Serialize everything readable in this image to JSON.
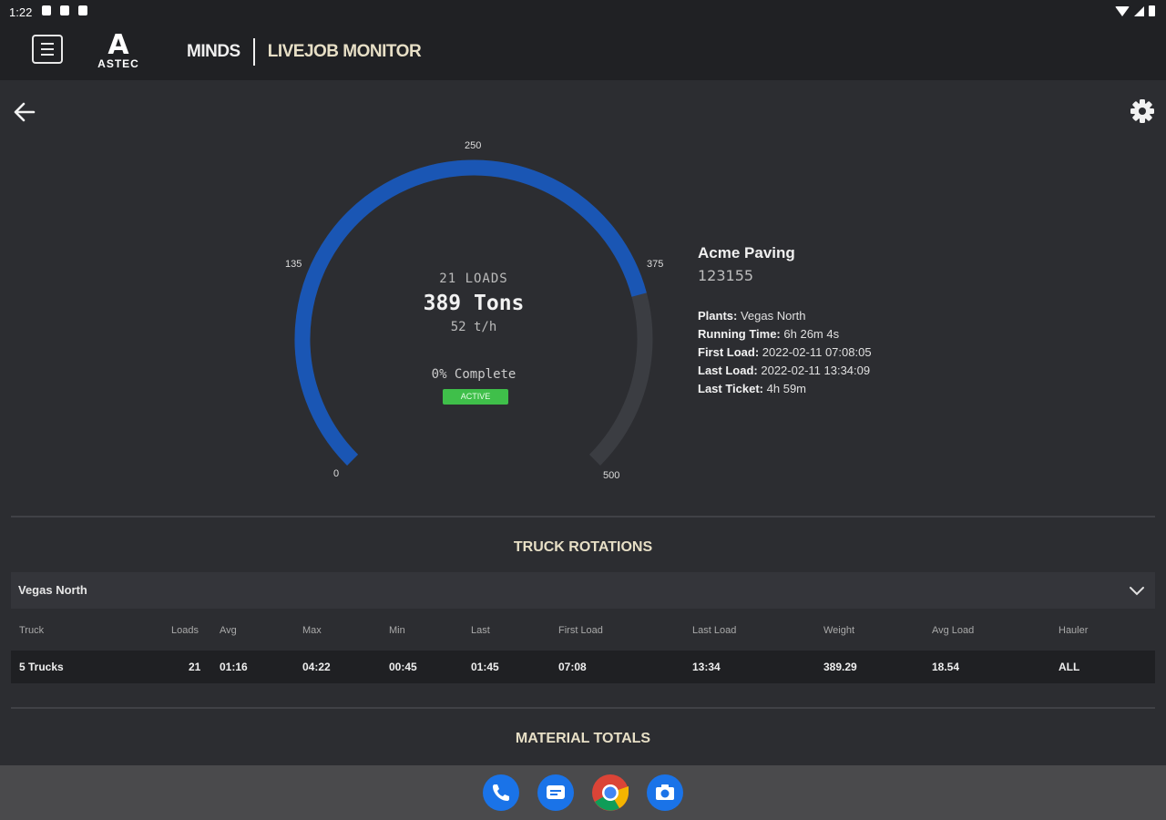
{
  "status_bar": {
    "time": "1:22"
  },
  "app_bar": {
    "logo_letter": "A",
    "logo_text": "ASTEC",
    "title_part1": "MINDS",
    "title_part2": "LIVEJOB MONITOR"
  },
  "gauge": {
    "ticks": {
      "t0": "0",
      "t135": "135",
      "t250": "250",
      "t375": "375",
      "t500": "500"
    },
    "max": 500,
    "value": 389,
    "loads": "21 LOADS",
    "tons": "389 Tons",
    "rate": "52 t/h",
    "complete": "0% Complete",
    "status": "ACTIVE",
    "colors": {
      "fill": "#1a56b4",
      "track": "#3b3d42",
      "status": "#3fbf4a"
    }
  },
  "job": {
    "customer": "Acme Paving",
    "number": "123155",
    "details": [
      {
        "label": "Plants:",
        "value": "Vegas North"
      },
      {
        "label": "Running Time:",
        "value": "6h 26m 4s"
      },
      {
        "label": "First Load:",
        "value": "2022-02-11 07:08:05"
      },
      {
        "label": "Last Load:",
        "value": "2022-02-11 13:34:09"
      },
      {
        "label": "Last Ticket:",
        "value": "4h 59m"
      }
    ]
  },
  "truck_rotations": {
    "title": "TRUCK ROTATIONS",
    "plant": "Vegas North",
    "headers": [
      "Truck",
      "Loads",
      "Avg",
      "Max",
      "Min",
      "Last",
      "First Load",
      "Last Load",
      "Weight",
      "Avg Load",
      "Hauler"
    ],
    "row": [
      "5 Trucks",
      "21",
      "01:16",
      "04:22",
      "00:45",
      "01:45",
      "07:08",
      "13:34",
      "389.29",
      "18.54",
      "ALL"
    ]
  },
  "material_totals": {
    "title": "MATERIAL TOTALS"
  },
  "nav_icons": [
    "phone-icon",
    "messages-icon",
    "chrome-icon",
    "camera-icon"
  ]
}
